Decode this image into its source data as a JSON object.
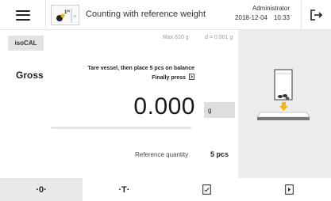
{
  "header": {
    "title": "Counting with reference weight",
    "user": "Administrator",
    "date": "2018-12-04",
    "time": "10:33",
    "app_icon_label": "1²⁾"
  },
  "balance": {
    "max": "Max 620 g",
    "d": "d = 0.001 g",
    "iso_cal_label": "isoCAL",
    "mode_label": "Gross",
    "instruction_1": "Tare vessel, then place 5 pcs on balance",
    "instruction_2": "Finally press",
    "value": "0.000",
    "unit": "g",
    "progress_fraction": 0.0,
    "reference_label": "Reference quantity",
    "reference_value": "5 pcs"
  },
  "toolbar": {
    "zero_label": "·0·",
    "tare_label": "·T·"
  },
  "icons": {
    "menu": "hamburger-icon",
    "logout": "logout-icon",
    "app": "counting-app-icon",
    "confirm": "document-check-icon",
    "print": "document-arrow-icon"
  }
}
